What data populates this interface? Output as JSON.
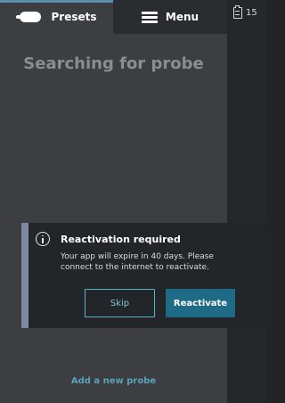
{
  "tabs": {
    "presets_label": "Presets",
    "menu_label": "Menu"
  },
  "side": {
    "badge_count": "15"
  },
  "main": {
    "title": "Searching for probe",
    "add_probe_link": "Add a new probe"
  },
  "dialog": {
    "title": "Reactivation required",
    "message": "Your app will expire in 40 days. Please connect to the internet to reactivate.",
    "skip_label": "Skip",
    "reactivate_label": "Reactivate"
  },
  "colors": {
    "accent": "#5aa3bd",
    "primary_button": "#1f6a86",
    "dialog_bar": "#7e8aa5",
    "background": "#3c3e41"
  }
}
